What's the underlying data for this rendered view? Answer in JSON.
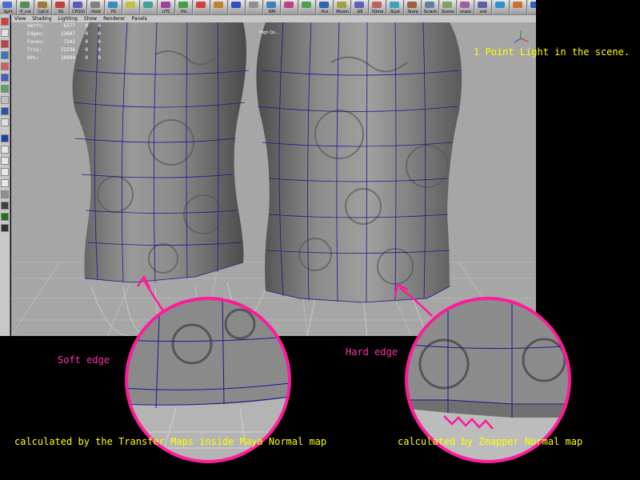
{
  "shelf": {
    "buttons": [
      {
        "label": "Split",
        "color": "#4a6fd0"
      },
      {
        "label": "P_cut",
        "color": "#5a8a5a"
      },
      {
        "label": "CpCd",
        "color": "#9a7a3a"
      },
      {
        "label": "SS",
        "color": "#c04040"
      },
      {
        "label": "CPOOI",
        "color": "#5a5ac0"
      },
      {
        "label": "HoId",
        "color": "#808080"
      },
      {
        "label": "PS",
        "color": "#3a8ac0"
      },
      {
        "label": "",
        "color": "#c0c040"
      },
      {
        "label": "",
        "color": "#40a0a0"
      },
      {
        "label": "UTC",
        "color": "#a040a0"
      },
      {
        "label": "Hic",
        "color": "#40a040"
      },
      {
        "label": "",
        "color": "#d04040"
      },
      {
        "label": "",
        "color": "#c08030"
      },
      {
        "label": "",
        "color": "#3050c0"
      },
      {
        "label": "",
        "color": "#909090"
      },
      {
        "label": "NM",
        "color": "#4080c0"
      },
      {
        "label": "",
        "color": "#c04080"
      },
      {
        "label": "",
        "color": "#50a050"
      },
      {
        "label": "Hul",
        "color": "#3060b0"
      },
      {
        "label": "9fxam",
        "color": "#a0a040"
      },
      {
        "label": "GE",
        "color": "#6060c0"
      },
      {
        "label": "YUme",
        "color": "#c06060"
      },
      {
        "label": "SList",
        "color": "#40a0c0"
      },
      {
        "label": "Teore",
        "color": "#a06040"
      },
      {
        "label": "Scrash",
        "color": "#6080a0"
      },
      {
        "label": "Scene",
        "color": "#80a060"
      },
      {
        "label": "snare",
        "color": "#a060a0"
      },
      {
        "label": "srel",
        "color": "#6060a0"
      },
      {
        "label": "",
        "color": "#3090d0"
      },
      {
        "label": "",
        "color": "#d07030"
      },
      {
        "label": "",
        "color": "#3060c0"
      }
    ],
    "mel_label": "mel"
  },
  "panel_menu": [
    "View",
    "Shading",
    "Lighting",
    "Show",
    "Renderer",
    "Panels"
  ],
  "hud": {
    "rows": [
      {
        "name": "Verts:",
        "value": "6377",
        "a": "0",
        "b": "0"
      },
      {
        "name": "Edges:",
        "value": "13607",
        "a": "0",
        "b": "0"
      },
      {
        "name": "Faces:",
        "value": "7242",
        "a": "0",
        "b": "0"
      },
      {
        "name": "Tris:",
        "value": "12236",
        "a": "0",
        "b": "0"
      },
      {
        "name": "UVs:",
        "value": "10090",
        "a": "0",
        "b": "0"
      }
    ],
    "quality": "High Qu..."
  },
  "notes": {
    "light": "1 Point Light in the scene.",
    "soft_edge": "Soft edge",
    "hard_edge": "Hard edge",
    "maya_caption": "calculated by the Transfer Maps inside Maya Normal map",
    "zmapper_caption": "calculated by Zmapper Normal map"
  },
  "colors": {
    "annotation_pink": "#ff33aa",
    "caption_yellow": "#ffff00",
    "wire_blue": "#1a1a8c",
    "viewport_gray": "#a6a6a6"
  }
}
